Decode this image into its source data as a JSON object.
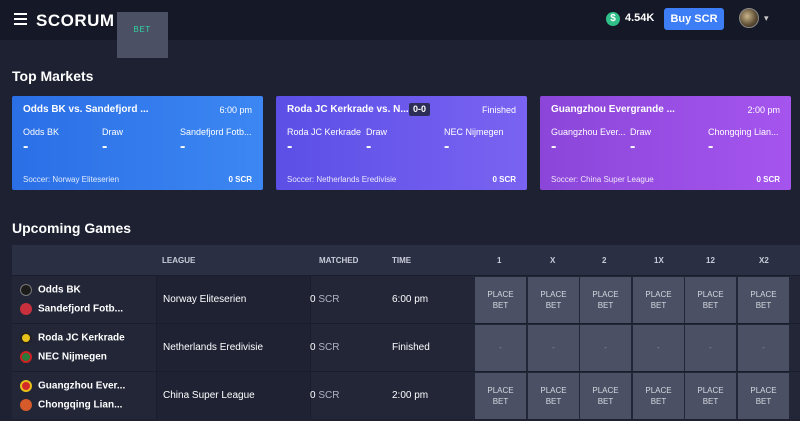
{
  "header": {
    "logo_main": "SCORUM",
    "logo_accent": "BET",
    "balance": "4.54K",
    "buy_label": "Buy SCR",
    "balance_icon_glyph": "$"
  },
  "top_markets": {
    "title": "Top Markets",
    "cards": [
      {
        "title": "Odds BK vs. Sandefjord ...",
        "time": "6:00 pm",
        "score": "",
        "home": "Odds BK",
        "draw": "Draw",
        "away": "Sandefjord Fotb...",
        "odd_home": "-",
        "odd_draw": "-",
        "odd_away": "-",
        "league": "Soccer: Norway Eliteserien",
        "scr": "0 SCR"
      },
      {
        "title": "Roda JC Kerkrade vs. N...",
        "time": "Finished",
        "score": "0-0",
        "home": "Roda JC Kerkrade",
        "draw": "Draw",
        "away": "NEC Nijmegen",
        "odd_home": "-",
        "odd_draw": "-",
        "odd_away": "-",
        "league": "Soccer: Netherlands Eredivisie",
        "scr": "0 SCR"
      },
      {
        "title": "Guangzhou Evergrande ...",
        "time": "2:00 pm",
        "score": "",
        "home": "Guangzhou Ever...",
        "draw": "Draw",
        "away": "Chongqing Lian...",
        "odd_home": "-",
        "odd_draw": "-",
        "odd_away": "-",
        "league": "Soccer: China Super League",
        "scr": "0 SCR"
      }
    ]
  },
  "upcoming": {
    "title": "Upcoming Games",
    "columns": {
      "league": "LEAGUE",
      "matched": "MATCHED",
      "time": "TIME",
      "c1": "1",
      "cx": "X",
      "c2": "2",
      "c1x": "1X",
      "c12": "12",
      "cx2": "X2"
    },
    "place_bet_line1": "PLACE",
    "place_bet_line2": "BET",
    "unavailable": "-",
    "rows": [
      {
        "home": "Odds BK",
        "away": "Sandefjord Fotb...",
        "league": "Norway Eliteserien",
        "matched_value": "0",
        "matched_unit": "SCR",
        "time": "6:00 pm",
        "home_color": "#1b1b1b",
        "away_color": "#c7303c"
      },
      {
        "home": "Roda JC Kerkrade",
        "away": "NEC Nijmegen",
        "league": "Netherlands Eredivisie",
        "matched_value": "0",
        "matched_unit": "SCR",
        "time": "Finished",
        "home_color": "#e7c019",
        "away_color": "#2a7a3a"
      },
      {
        "home": "Guangzhou Ever...",
        "away": "Chongqing Lian...",
        "league": "China Super League",
        "matched_value": "0",
        "matched_unit": "SCR",
        "time": "2:00 pm",
        "home_color": "#d62a2a",
        "away_color": "#d65a2a"
      }
    ]
  }
}
